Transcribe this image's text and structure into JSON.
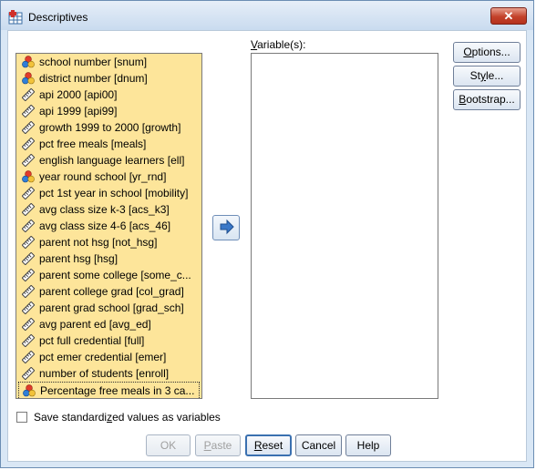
{
  "window": {
    "title": "Descriptives",
    "close_glyph": "✕"
  },
  "source_list": {
    "items": [
      {
        "label": "school number [snum]",
        "icon": "nominal-icon"
      },
      {
        "label": "district number [dnum]",
        "icon": "nominal-icon"
      },
      {
        "label": "api 2000 [api00]",
        "icon": "scale-icon"
      },
      {
        "label": "api 1999 [api99]",
        "icon": "scale-icon"
      },
      {
        "label": "growth 1999 to 2000 [growth]",
        "icon": "scale-icon"
      },
      {
        "label": "pct free meals [meals]",
        "icon": "scale-icon"
      },
      {
        "label": "english language learners [ell]",
        "icon": "scale-icon"
      },
      {
        "label": "year round school [yr_rnd]",
        "icon": "nominal-icon"
      },
      {
        "label": "pct 1st year in school [mobility]",
        "icon": "scale-icon"
      },
      {
        "label": "avg class size k-3 [acs_k3]",
        "icon": "scale-icon"
      },
      {
        "label": "avg class size 4-6 [acs_46]",
        "icon": "scale-icon"
      },
      {
        "label": "parent not hsg [not_hsg]",
        "icon": "scale-icon"
      },
      {
        "label": "parent hsg [hsg]",
        "icon": "scale-icon"
      },
      {
        "label": "parent some college [some_c...",
        "icon": "scale-icon"
      },
      {
        "label": "parent college grad [col_grad]",
        "icon": "scale-icon"
      },
      {
        "label": "parent grad school [grad_sch]",
        "icon": "scale-icon"
      },
      {
        "label": "avg parent ed [avg_ed]",
        "icon": "scale-icon"
      },
      {
        "label": "pct full credential [full]",
        "icon": "scale-icon"
      },
      {
        "label": "pct emer credential [emer]",
        "icon": "scale-icon"
      },
      {
        "label": "number of students [enroll]",
        "icon": "scale-icon"
      },
      {
        "label": "Percentage free meals in 3 ca...",
        "icon": "nominal-icon",
        "focused": true
      }
    ]
  },
  "target": {
    "label_prefix": "",
    "label_underlined": "V",
    "label_rest": "ariable(s):"
  },
  "move_button": {
    "icon": "arrow-right-icon"
  },
  "side_buttons": [
    {
      "name": "options-button",
      "pre": "",
      "ul": "O",
      "post": "ptions..."
    },
    {
      "name": "style-button",
      "pre": "St",
      "ul": "y",
      "post": "le..."
    },
    {
      "name": "bootstrap-button",
      "pre": "",
      "ul": "B",
      "post": "ootstrap..."
    }
  ],
  "checkbox": {
    "pre": "Save standardi",
    "ul": "z",
    "post": "ed values as variables",
    "checked": false
  },
  "bottom_buttons": {
    "ok": "OK",
    "paste_pre": "",
    "paste_ul": "P",
    "paste_post": "aste",
    "reset_pre": "",
    "reset_ul": "R",
    "reset_post": "eset",
    "cancel": "Cancel",
    "help": "Help"
  },
  "colors": {
    "source_bg": "#fde59a",
    "window_bg": "#d9e7f5",
    "accent": "#3a70b0"
  }
}
